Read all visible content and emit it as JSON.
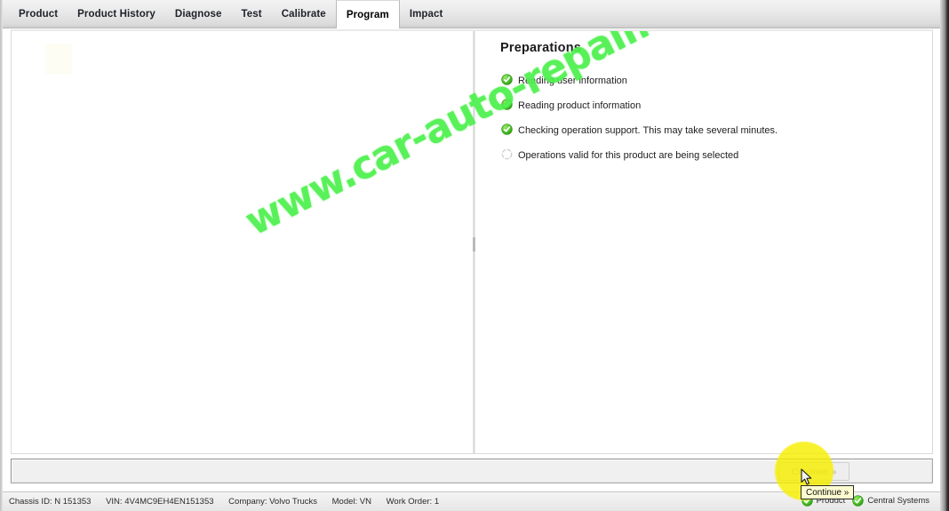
{
  "tabs": [
    {
      "label": "Product",
      "active": false
    },
    {
      "label": "Product History",
      "active": false
    },
    {
      "label": "Diagnose",
      "active": false
    },
    {
      "label": "Test",
      "active": false
    },
    {
      "label": "Calibrate",
      "active": false
    },
    {
      "label": "Program",
      "active": true
    },
    {
      "label": "Impact",
      "active": false
    }
  ],
  "preparations": {
    "title": "Preparations",
    "items": [
      {
        "label": "Reading user information",
        "state": "done"
      },
      {
        "label": "Reading product information",
        "state": "done"
      },
      {
        "label": "Checking operation support. This may take several minutes.",
        "state": "done"
      },
      {
        "label": "Operations valid for this product are being selected",
        "state": "pending"
      }
    ]
  },
  "watermark": {
    "text": "www.car-auto-repair.com",
    "color": "#4cf04c"
  },
  "toolbar": {
    "continue_label": "Continue »"
  },
  "tooltip": {
    "text": "Continue »"
  },
  "statusbar": {
    "chassis_id_label": "Chassis ID:",
    "chassis_id_value": "N 151353",
    "vin_label": "VIN:",
    "vin_value": "4V4MC9EH4EN151353",
    "company_label": "Company:",
    "company_value": "Volvo Trucks",
    "model_label": "Model:",
    "model_value": "VN",
    "work_order_label": "Work Order:",
    "work_order_value": "1",
    "connections": [
      {
        "label": "Product",
        "state": "ok"
      },
      {
        "label": "Central Systems",
        "state": "ok"
      }
    ]
  },
  "colors": {
    "accent_green": "#3cb521",
    "highlight_yellow": "#f7ef00",
    "tab_active_bg": "#ffffff"
  }
}
